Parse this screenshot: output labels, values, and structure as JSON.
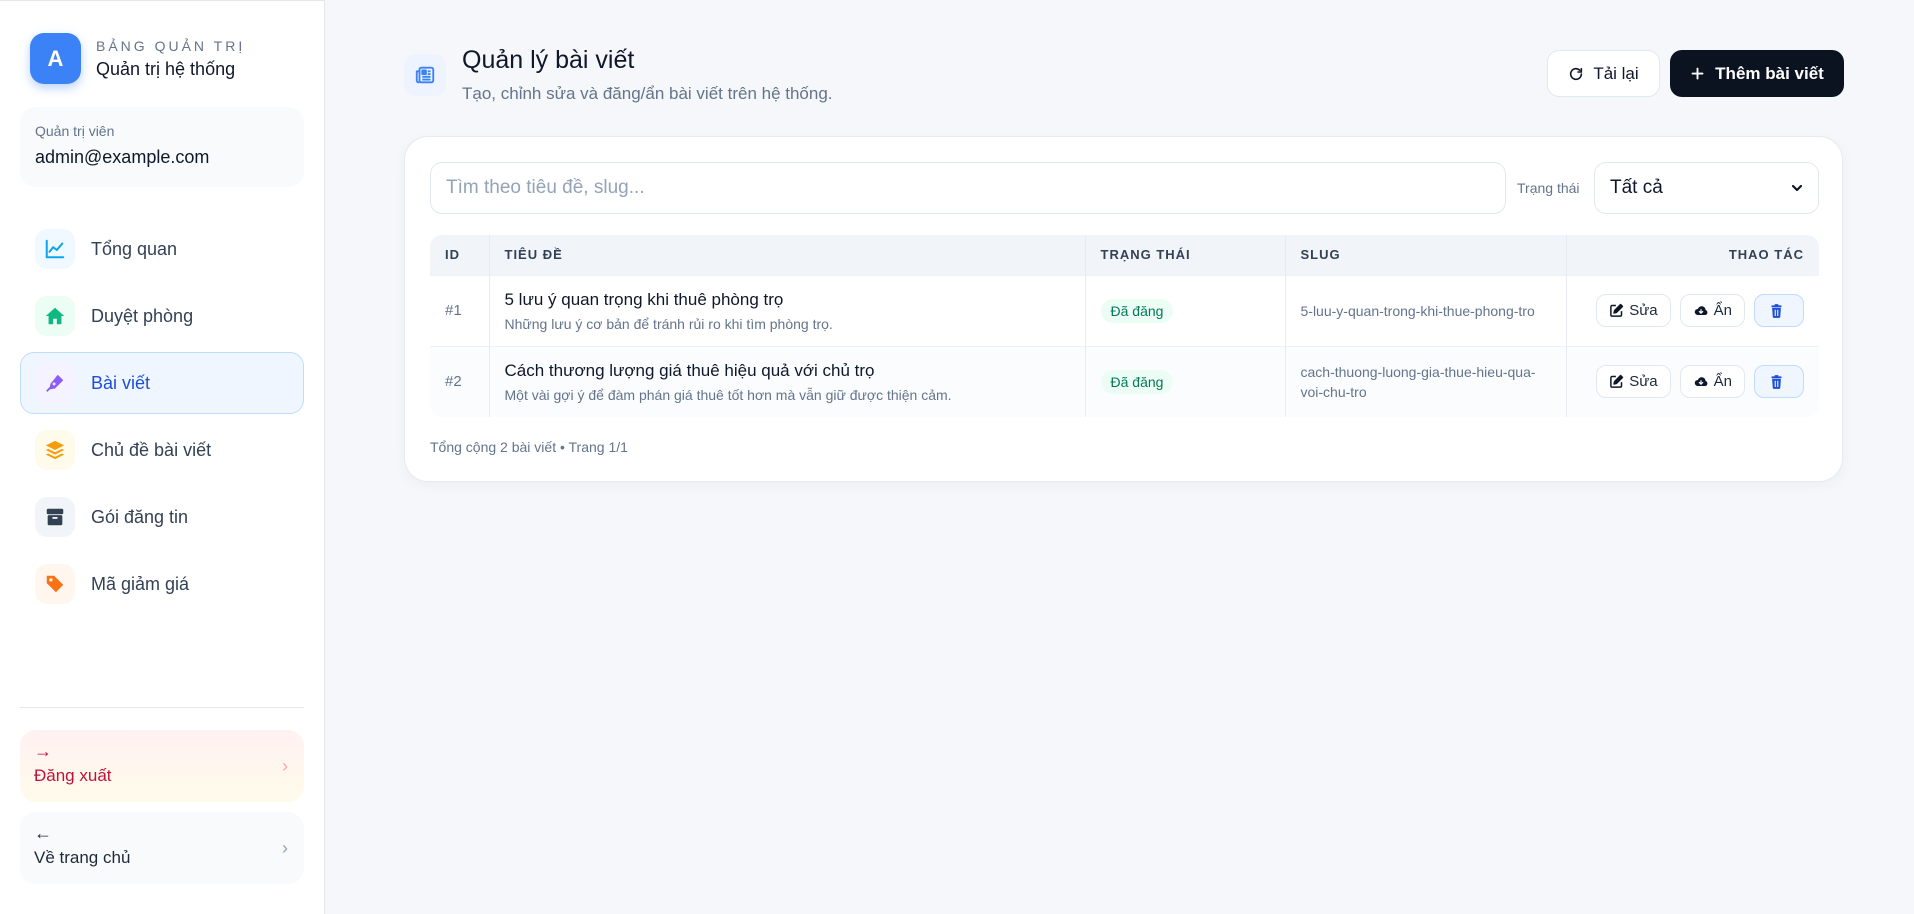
{
  "sidebar": {
    "brand": {
      "avatar_letter": "A",
      "kicker": "BẢNG QUẢN TRỊ",
      "title": "Quản trị hệ thống"
    },
    "admin": {
      "role": "Quản trị viên",
      "email": "admin@example.com"
    },
    "nav": [
      {
        "label": "Tổng quan",
        "icon": "chart-line-icon",
        "color": "#0ea5e9",
        "bg": "#f0f9ff"
      },
      {
        "label": "Duyệt phòng",
        "icon": "home-icon",
        "color": "#10b981",
        "bg": "#ecfdf5"
      },
      {
        "label": "Bài viết",
        "icon": "pen-nib-icon",
        "color": "#8b5cf6",
        "bg": "#f5f3ff",
        "active": true
      },
      {
        "label": "Chủ đề bài viết",
        "icon": "layers-icon",
        "color": "#f59e0b",
        "bg": "#fffbeb"
      },
      {
        "label": "Gói đăng tin",
        "icon": "box-icon",
        "color": "#334155",
        "bg": "#f1f5f9"
      },
      {
        "label": "Mã giảm giá",
        "icon": "tag-icon",
        "color": "#f97316",
        "bg": "#fff7ed"
      }
    ],
    "logout": {
      "arrow": "→",
      "label": "Đăng xuất",
      "chevron": "›"
    },
    "home": {
      "arrow": "←",
      "label": "Về trang chủ",
      "chevron": "›"
    }
  },
  "header": {
    "icon": "newspaper-icon",
    "title": "Quản lý bài viết",
    "subtitle": "Tạo, chỉnh sửa và đăng/ẩn bài viết trên hệ thống.",
    "reload_label": "Tải lại",
    "add_label": "Thêm bài viết"
  },
  "filters": {
    "search_placeholder": "Tìm theo tiêu đề, slug...",
    "status_label": "Trạng thái",
    "status_value": "Tất cả"
  },
  "table": {
    "columns": [
      "ID",
      "TIÊU ĐỀ",
      "TRẠNG THÁI",
      "SLUG",
      "THAO TÁC"
    ],
    "rows": [
      {
        "id": "#1",
        "title": "5 lưu ý quan trọng khi thuê phòng trọ",
        "excerpt": "Những lưu ý cơ bản để tránh rủi ro khi tìm phòng trọ.",
        "status": "Đã đăng",
        "slug": "5-luu-y-quan-trong-khi-thue-phong-tro"
      },
      {
        "id": "#2",
        "title": "Cách thương lượng giá thuê hiệu quả với chủ trọ",
        "excerpt": "Một vài gợi ý để đàm phán giá thuê tốt hơn mà vẫn giữ được thiện cảm.",
        "status": "Đã đăng",
        "slug": "cach-thuong-luong-gia-thue-hieu-qua-voi-chu-tro"
      }
    ],
    "actions": {
      "edit": "Sửa",
      "hide": "Ẩn"
    }
  },
  "footer": {
    "summary": "Tổng cộng 2 bài viết • Trang 1/1"
  },
  "colors": {
    "accent": "#3b82f6",
    "dark_button": "#0b1220",
    "danger": "#be123c",
    "success": "#047857"
  }
}
